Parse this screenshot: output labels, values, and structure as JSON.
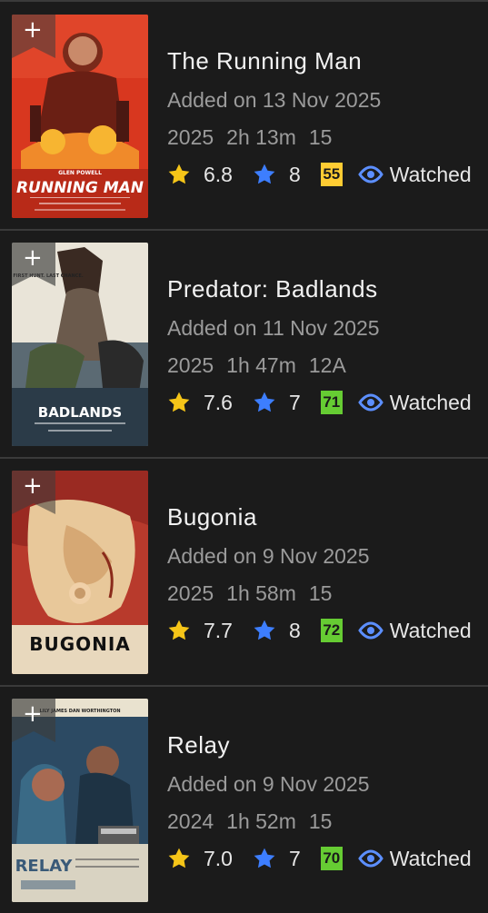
{
  "colors": {
    "background": "#1b1b1b",
    "divider": "#3a3a3a",
    "star_gold": "#f5c518",
    "star_blue": "#3d7eff",
    "eye_blue": "#5c8fff",
    "metascore_yellow": "#ffcc33",
    "metascore_green": "#66cc33"
  },
  "icons": {
    "add": "plus-icon",
    "imdb_rating": "gold-star-icon",
    "user_rating": "blue-star-icon",
    "watched": "eye-icon"
  },
  "movies": [
    {
      "title": "The Running Man",
      "added": "Added on 13 Nov 2025",
      "year": "2025",
      "runtime": "2h 13m",
      "certificate": "15",
      "rating": "6.8",
      "user_rating": "8",
      "metascore": "55",
      "metascore_color": "#ffcc33",
      "status": "Watched",
      "add_symbol": "+",
      "poster": {
        "top_text": "GLEN POWELL",
        "main_text": "RUNNING MAN"
      }
    },
    {
      "title": "Predator: Badlands",
      "added": "Added on 11 Nov 2025",
      "year": "2025",
      "runtime": "1h 47m",
      "certificate": "12A",
      "rating": "7.6",
      "user_rating": "7",
      "metascore": "71",
      "metascore_color": "#66cc33",
      "status": "Watched",
      "add_symbol": "+",
      "poster": {
        "top_text": "FIRST HUNT.   LAST CHANCE.",
        "main_text": "BADLANDS"
      }
    },
    {
      "title": "Bugonia",
      "added": "Added on 9 Nov 2025",
      "year": "2025",
      "runtime": "1h 58m",
      "certificate": "15",
      "rating": "7.7",
      "user_rating": "8",
      "metascore": "72",
      "metascore_color": "#66cc33",
      "status": "Watched",
      "add_symbol": "+",
      "poster": {
        "top_text": "",
        "main_text": "BUGONIA"
      }
    },
    {
      "title": "Relay",
      "added": "Added on 9 Nov 2025",
      "year": "2024",
      "runtime": "1h 52m",
      "certificate": "15",
      "rating": "7.0",
      "user_rating": "7",
      "metascore": "70",
      "metascore_color": "#66cc33",
      "status": "Watched",
      "add_symbol": "+",
      "poster": {
        "top_text": "LILY JAMES     DAN WORTHINGTON",
        "main_text": "RELAY"
      }
    }
  ]
}
